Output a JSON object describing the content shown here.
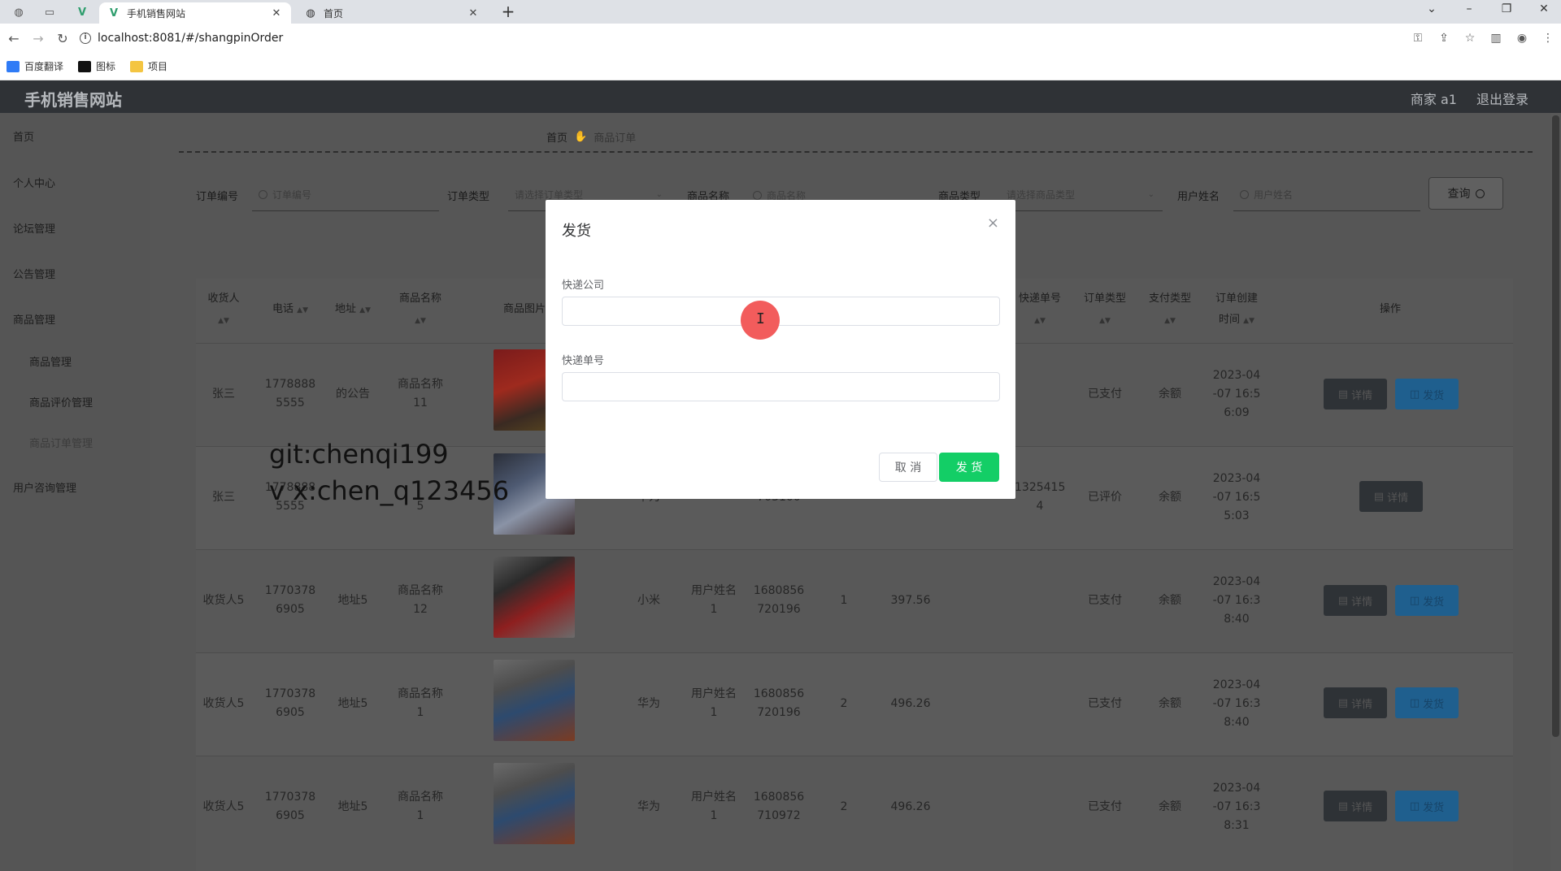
{
  "browser": {
    "tabs": [
      {
        "title": "手机销售网站",
        "close": "✕",
        "icon": "vue-logo-icon"
      },
      {
        "title": "首页",
        "close": "✕",
        "icon": "globe-icon"
      }
    ],
    "new_tab": "+",
    "url": "localhost:8081/#/shangpinOrder",
    "bookmarks": [
      {
        "label": "百度翻译",
        "color": "#2f7bf6"
      },
      {
        "label": "图标",
        "color": "#111111"
      },
      {
        "label": "项目",
        "color": "#f4c542"
      }
    ]
  },
  "app": {
    "title": "手机销售网站",
    "user": "商家 a1",
    "logout": "退出登录"
  },
  "sidebar": {
    "items": [
      {
        "label": "首页"
      },
      {
        "label": "个人中心"
      },
      {
        "label": "论坛管理"
      },
      {
        "label": "公告管理"
      },
      {
        "label": "商品管理"
      },
      {
        "label": "商品管理"
      },
      {
        "label": "商品评价管理"
      },
      {
        "label": "商品订单管理"
      },
      {
        "label": "用户咨询管理"
      }
    ]
  },
  "breadcrumb": {
    "home": "首页",
    "current": "商品订单"
  },
  "filters": {
    "order_no_label": "订单编号",
    "order_no_placeholder": "订单编号",
    "order_type_label": "订单类型",
    "order_type_placeholder": "请选择订单类型",
    "product_name_label": "商品名称",
    "product_name_placeholder": "商品名称",
    "product_type_label": "商品类型",
    "product_type_placeholder": "请选择商品类型",
    "user_name_label": "用户姓名",
    "user_name_placeholder": "用户姓名",
    "search_button": "查询"
  },
  "table": {
    "headers": {
      "receiver": "收货人",
      "phone": "电话",
      "address": "地址",
      "product_name": "商品名称",
      "product_image": "商品图片",
      "express_no": "快递单号",
      "order_type": "订单类型",
      "pay_type": "支付类型",
      "created_1": "订单创建",
      "created_2": "时间",
      "actions": "操作"
    },
    "detail_label": "详情",
    "ship_label": "发货",
    "rows": [
      {
        "receiver": "张三",
        "phone1": "1778888",
        "phone2": "5555",
        "address": "的公告",
        "pname1": "商品名称",
        "pname2": "11",
        "brand": "",
        "user1": "",
        "user2": "",
        "order1": "",
        "order2": "",
        "qty": "",
        "price": "",
        "code": "",
        "express1": "",
        "express2": "",
        "order_type": "已支付",
        "pay_type": "余额",
        "t1": "2023-04",
        "t2": "-07 16:5",
        "t3": "6:09",
        "ship": true
      },
      {
        "receiver": "张三",
        "phone1": "1778888",
        "phone2": "5555",
        "address": "",
        "pname1": "",
        "pname2": "5",
        "brand": "华为",
        "user1": "",
        "user2": "",
        "order1": "",
        "order2": "703100",
        "qty": "",
        "price": "",
        "code": "",
        "express1": "1325415",
        "express2": "4",
        "order_type": "已评价",
        "pay_type": "余额",
        "t1": "2023-04",
        "t2": "-07 16:5",
        "t3": "5:03",
        "ship": false
      },
      {
        "receiver": "收货人5",
        "phone1": "1770378",
        "phone2": "6905",
        "address": "地址5",
        "pname1": "商品名称",
        "pname2": "12",
        "brand": "小米",
        "user1": "用户姓名",
        "user2": "1",
        "order1": "1680856",
        "order2": "720196",
        "qty": "1",
        "price": "397.56",
        "code": "",
        "express1": "",
        "express2": "",
        "order_type": "已支付",
        "pay_type": "余额",
        "t1": "2023-04",
        "t2": "-07 16:3",
        "t3": "8:40",
        "ship": true
      },
      {
        "receiver": "收货人5",
        "phone1": "1770378",
        "phone2": "6905",
        "address": "地址5",
        "pname1": "商品名称",
        "pname2": "1",
        "brand": "华为",
        "user1": "用户姓名",
        "user2": "1",
        "order1": "1680856",
        "order2": "720196",
        "qty": "2",
        "price": "496.26",
        "code": "",
        "express1": "",
        "express2": "",
        "order_type": "已支付",
        "pay_type": "余额",
        "t1": "2023-04",
        "t2": "-07 16:3",
        "t3": "8:40",
        "ship": true
      },
      {
        "receiver": "收货人5",
        "phone1": "1770378",
        "phone2": "6905",
        "address": "地址5",
        "pname1": "商品名称",
        "pname2": "1",
        "brand": "华为",
        "user1": "用户姓名",
        "user2": "1",
        "order1": "1680856",
        "order2": "710972",
        "qty": "2",
        "price": "496.26",
        "code": "",
        "express1": "",
        "express2": "",
        "order_type": "已支付",
        "pay_type": "余额",
        "t1": "2023-04",
        "t2": "-07 16:3",
        "t3": "8:31",
        "ship": true
      }
    ]
  },
  "watermark": {
    "line1": "git:chenqi199",
    "line2": "v x:chen_q123456"
  },
  "dialog": {
    "title": "发货",
    "close": "×",
    "company_label": "快递公司",
    "company_value": "",
    "tracking_label": "快递单号",
    "tracking_value": "",
    "cancel": "取 消",
    "confirm": "发 货"
  }
}
